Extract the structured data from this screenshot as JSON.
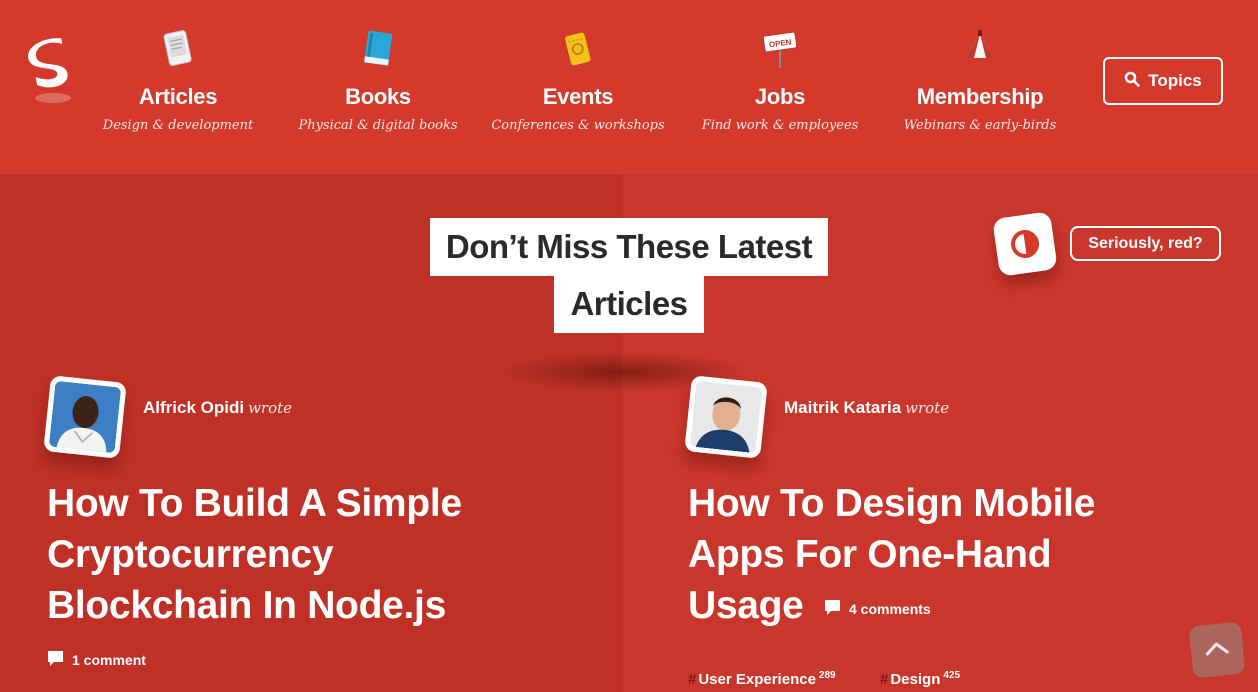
{
  "nav": {
    "items": [
      {
        "title": "Articles",
        "subtitle": "Design & development",
        "icon": "ereader-icon"
      },
      {
        "title": "Books",
        "subtitle": "Physical & digital books",
        "icon": "book-icon"
      },
      {
        "title": "Events",
        "subtitle": "Conferences & workshops",
        "icon": "ticket-icon"
      },
      {
        "title": "Jobs",
        "subtitle": "Find work & employees",
        "icon": "open-sign-icon"
      },
      {
        "title": "Membership",
        "subtitle": "Webinars & early-birds",
        "icon": "tent-icon"
      }
    ],
    "topics_label": "Topics"
  },
  "main": {
    "heading_line1": "Don’t Miss These Latest",
    "heading_line2": "Articles",
    "seriously_label": "Seriously, red?"
  },
  "articles": [
    {
      "author": "Alfrick Opidi",
      "wrote": "wrote",
      "title_lines": [
        "How To Build A Simple",
        "Cryptocurrency",
        "Blockchain In Node.js"
      ],
      "comments": "1 comment"
    },
    {
      "author": "Maitrik Kataria",
      "wrote": "wrote",
      "title_lines": [
        "How To Design Mobile",
        "Apps For One-Hand",
        "Usage"
      ],
      "comments": "4 comments",
      "tags": [
        {
          "label": "User Experience",
          "count": "289"
        },
        {
          "label": "Design",
          "count": "425"
        }
      ]
    }
  ],
  "colors": {
    "header_bg": "#d33a2c",
    "left_bg": "#bf3127",
    "right_bg": "#c9372c"
  }
}
